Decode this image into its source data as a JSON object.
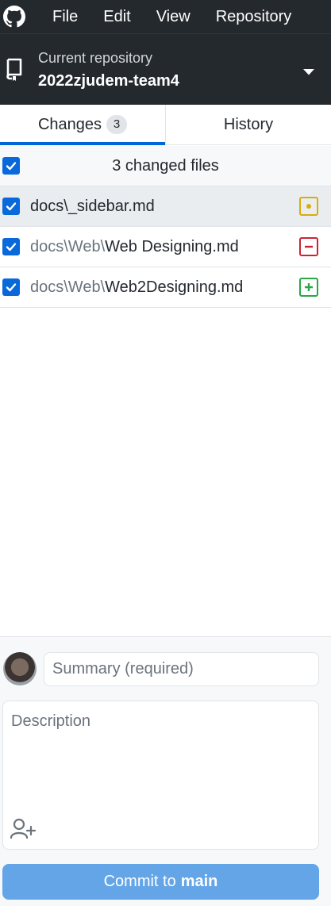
{
  "app": {
    "logo_icon": "github-mark-icon"
  },
  "menu": {
    "items": [
      "File",
      "Edit",
      "View",
      "Repository"
    ]
  },
  "repository": {
    "caption": "Current repository",
    "name": "2022zjudem-team4",
    "icon": "repo-icon",
    "dropdown_icon": "caret-down-icon"
  },
  "tabs": {
    "changes": {
      "label": "Changes",
      "count": "3"
    },
    "history": {
      "label": "History"
    },
    "active": "changes",
    "accent_color": "#0366d6"
  },
  "changes": {
    "header_label": "3 changed files",
    "all_selected": true,
    "files": [
      {
        "dir": "docs\\",
        "name": "_sidebar.md",
        "status": "modified",
        "status_color": "#dbab09",
        "checked": true,
        "selected": true
      },
      {
        "dir": "docs\\Web\\",
        "name": "Web Designing.md",
        "status": "deleted",
        "status_color": "#cb2431",
        "checked": true,
        "selected": false
      },
      {
        "dir": "docs\\Web\\",
        "name": "Web2Designing.md",
        "status": "added",
        "status_color": "#28a745",
        "checked": true,
        "selected": false
      }
    ]
  },
  "commit": {
    "summary_placeholder": "Summary (required)",
    "description_placeholder": "Description",
    "coauthor_icon": "add-coauthor-icon",
    "button_prefix": "Commit to",
    "branch": "main",
    "button_color": "#64a5e8"
  }
}
